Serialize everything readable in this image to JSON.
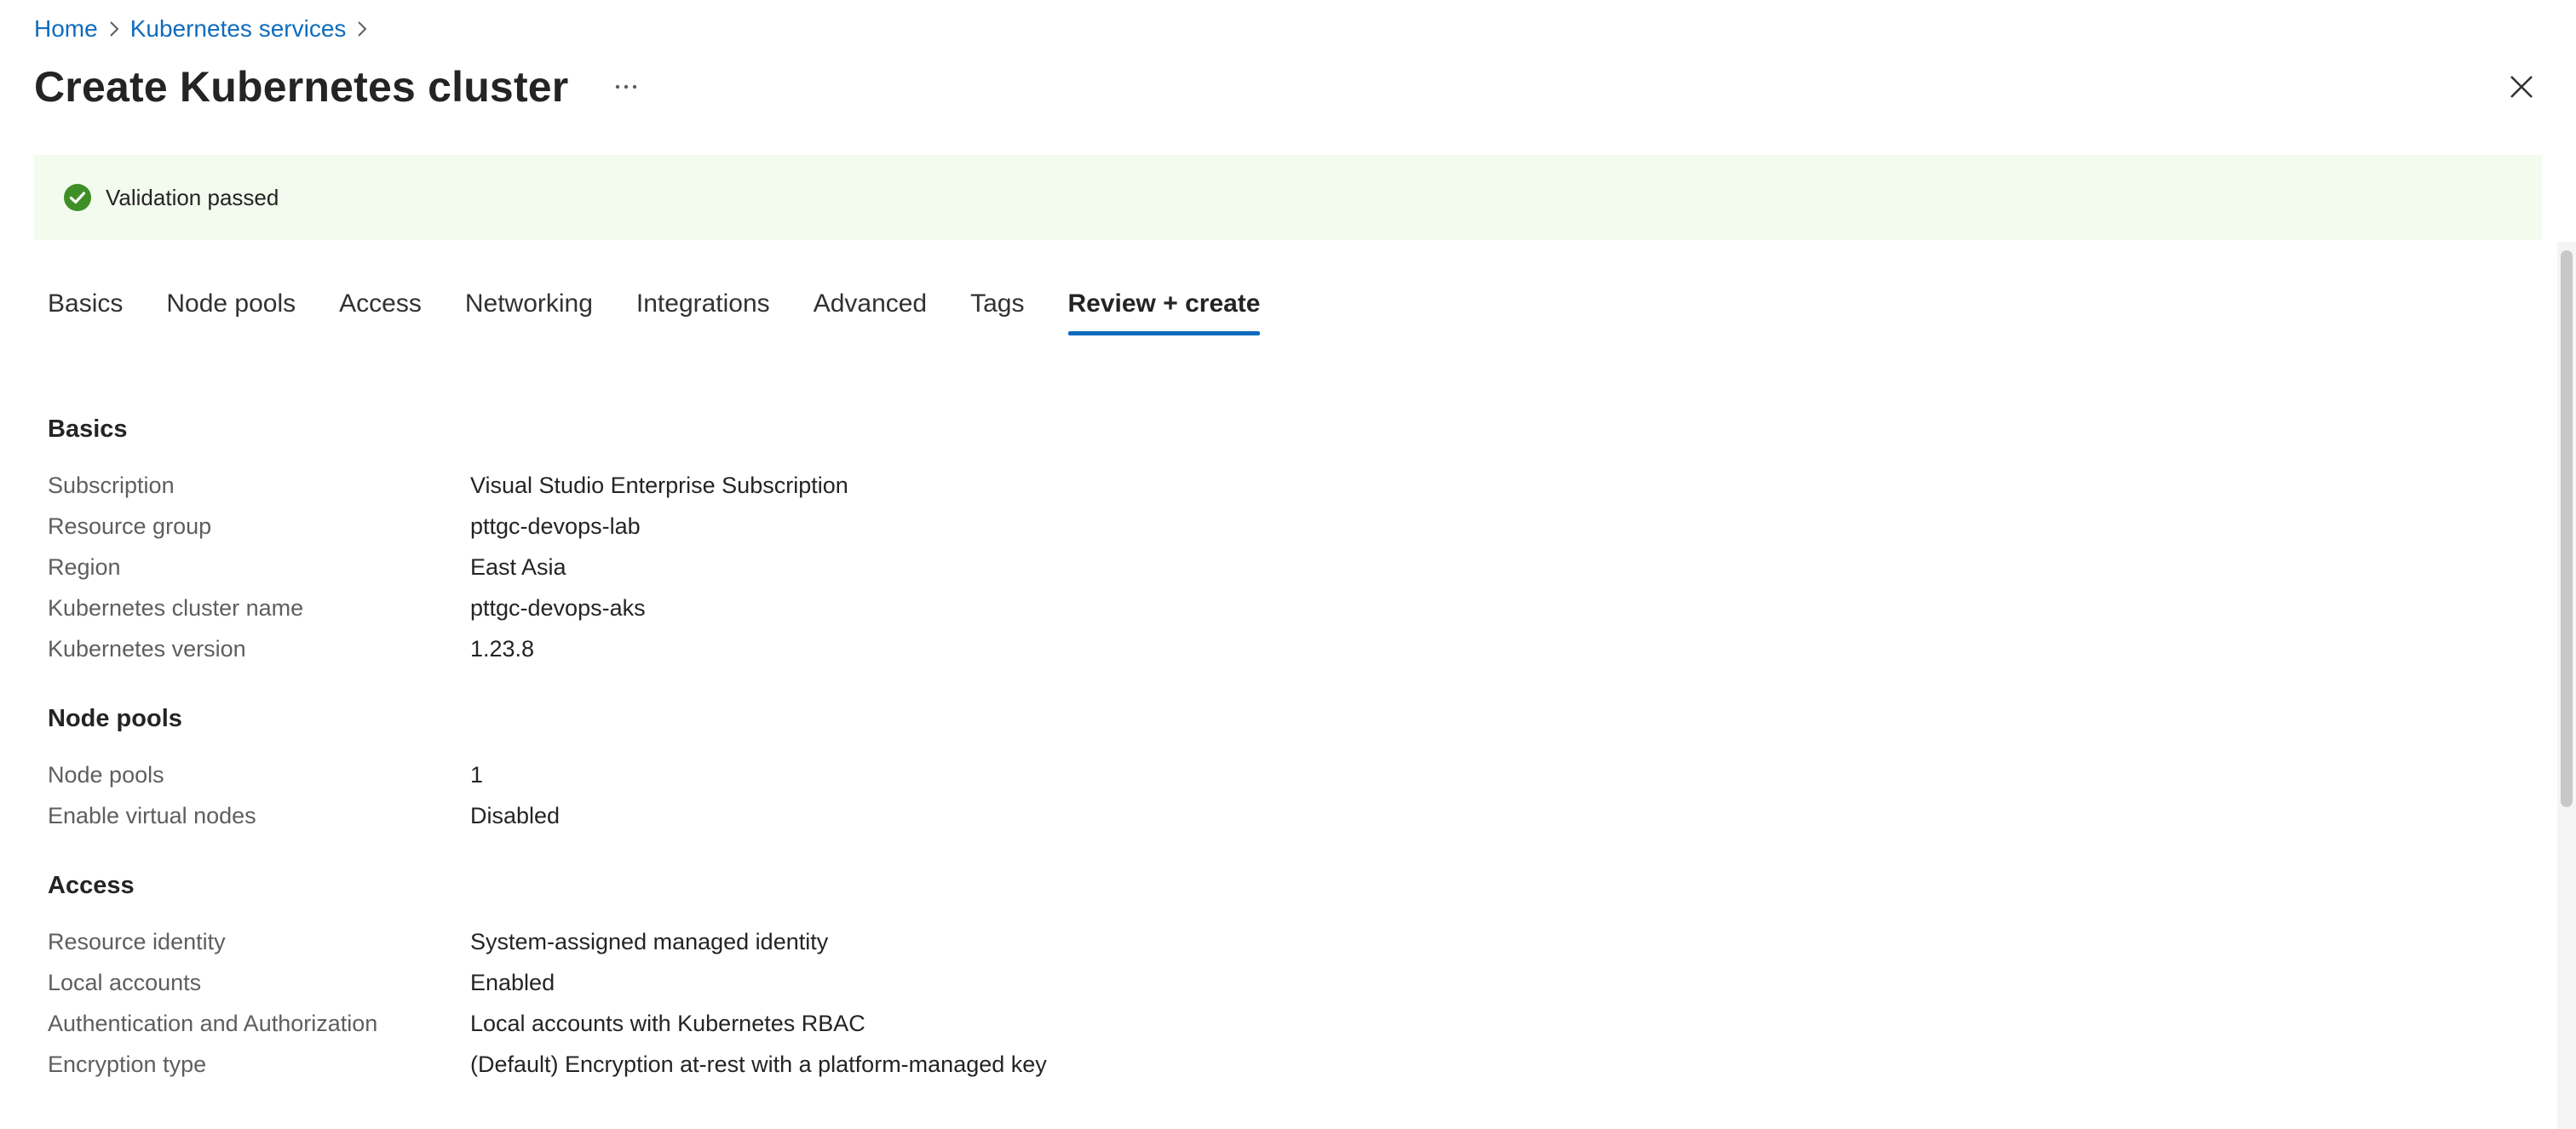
{
  "breadcrumb": {
    "home": "Home",
    "services": "Kubernetes services"
  },
  "header": {
    "title": "Create Kubernetes cluster",
    "more_label": "···"
  },
  "banner": {
    "text": "Validation passed",
    "color": "#3e8f26"
  },
  "tabs": [
    "Basics",
    "Node pools",
    "Access",
    "Networking",
    "Integrations",
    "Advanced",
    "Tags",
    "Review + create"
  ],
  "active_tab": "Review + create",
  "sections": {
    "basics": {
      "title": "Basics",
      "rows": [
        {
          "label": "Subscription",
          "value": "Visual Studio Enterprise Subscription"
        },
        {
          "label": "Resource group",
          "value": "pttgc-devops-lab"
        },
        {
          "label": "Region",
          "value": "East Asia"
        },
        {
          "label": "Kubernetes cluster name",
          "value": "pttgc-devops-aks"
        },
        {
          "label": "Kubernetes version",
          "value": "1.23.8"
        }
      ]
    },
    "node_pools": {
      "title": "Node pools",
      "rows": [
        {
          "label": "Node pools",
          "value": "1"
        },
        {
          "label": "Enable virtual nodes",
          "value": "Disabled"
        }
      ]
    },
    "access": {
      "title": "Access",
      "rows": [
        {
          "label": "Resource identity",
          "value": "System-assigned managed identity"
        },
        {
          "label": "Local accounts",
          "value": "Enabled"
        },
        {
          "label": "Authentication and Authorization",
          "value": "Local accounts with Kubernetes RBAC"
        },
        {
          "label": "Encryption type",
          "value": "(Default) Encryption at-rest with a platform-managed key"
        }
      ]
    }
  },
  "colors": {
    "link": "#0f6cbd",
    "banner_bg": "#f3fbee",
    "tab_underline": "#0f6cbd"
  },
  "icons": {
    "breadcrumb_sep": "chevron-right-icon",
    "close": "close-icon",
    "status": "checkmark-circle-icon"
  }
}
